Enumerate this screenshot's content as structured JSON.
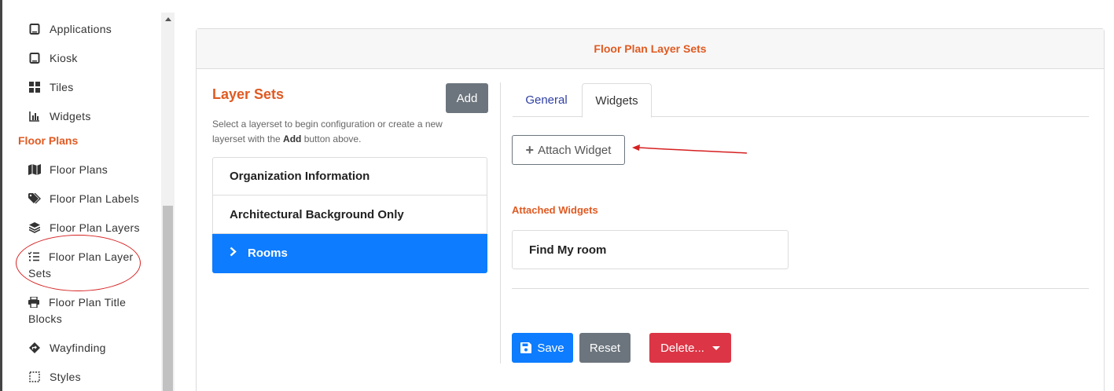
{
  "sidebar": {
    "items": [
      {
        "label": "Applications",
        "icon": "tablet-icon"
      },
      {
        "label": "Kiosk",
        "icon": "tablet-icon"
      },
      {
        "label": "Tiles",
        "icon": "tiles-icon"
      },
      {
        "label": "Widgets",
        "icon": "chart-icon"
      }
    ],
    "section_title": "Floor Plans",
    "floor_items": [
      {
        "label": "Floor Plans",
        "icon": "map-icon"
      },
      {
        "label": "Floor Plan Labels",
        "icon": "tags-icon"
      },
      {
        "label": "Floor Plan Layers",
        "icon": "layers-icon"
      },
      {
        "label": "Floor Plan Layer Sets",
        "icon": "list-check-icon"
      },
      {
        "label": "Floor Plan Title Blocks",
        "icon": "print-icon"
      },
      {
        "label": "Wayfinding",
        "icon": "directions-icon"
      },
      {
        "label": "Styles",
        "icon": "styles-icon"
      }
    ]
  },
  "card": {
    "title": "Floor Plan Layer Sets"
  },
  "layer_sets": {
    "title": "Layer Sets",
    "add_label": "Add",
    "help_before": "Select a layerset to begin configuration or create a new layerset with the ",
    "help_bold": "Add",
    "help_after": " button above.",
    "items": [
      "Organization Information",
      "Architectural Background Only",
      "Rooms"
    ],
    "active_index": 2
  },
  "tabs": [
    {
      "label": "General"
    },
    {
      "label": "Widgets"
    }
  ],
  "widgets": {
    "attach_label": "Attach Widget",
    "attached_title": "Attached Widgets",
    "attached_items": [
      "Find My room"
    ]
  },
  "actions": {
    "save_label": "Save",
    "reset_label": "Reset",
    "delete_label": "Delete..."
  },
  "colors": {
    "accent": "#e05a22",
    "primary": "#0d7cff",
    "secondary": "#6c757d",
    "danger": "#dc3545",
    "annotation": "#d62020"
  }
}
